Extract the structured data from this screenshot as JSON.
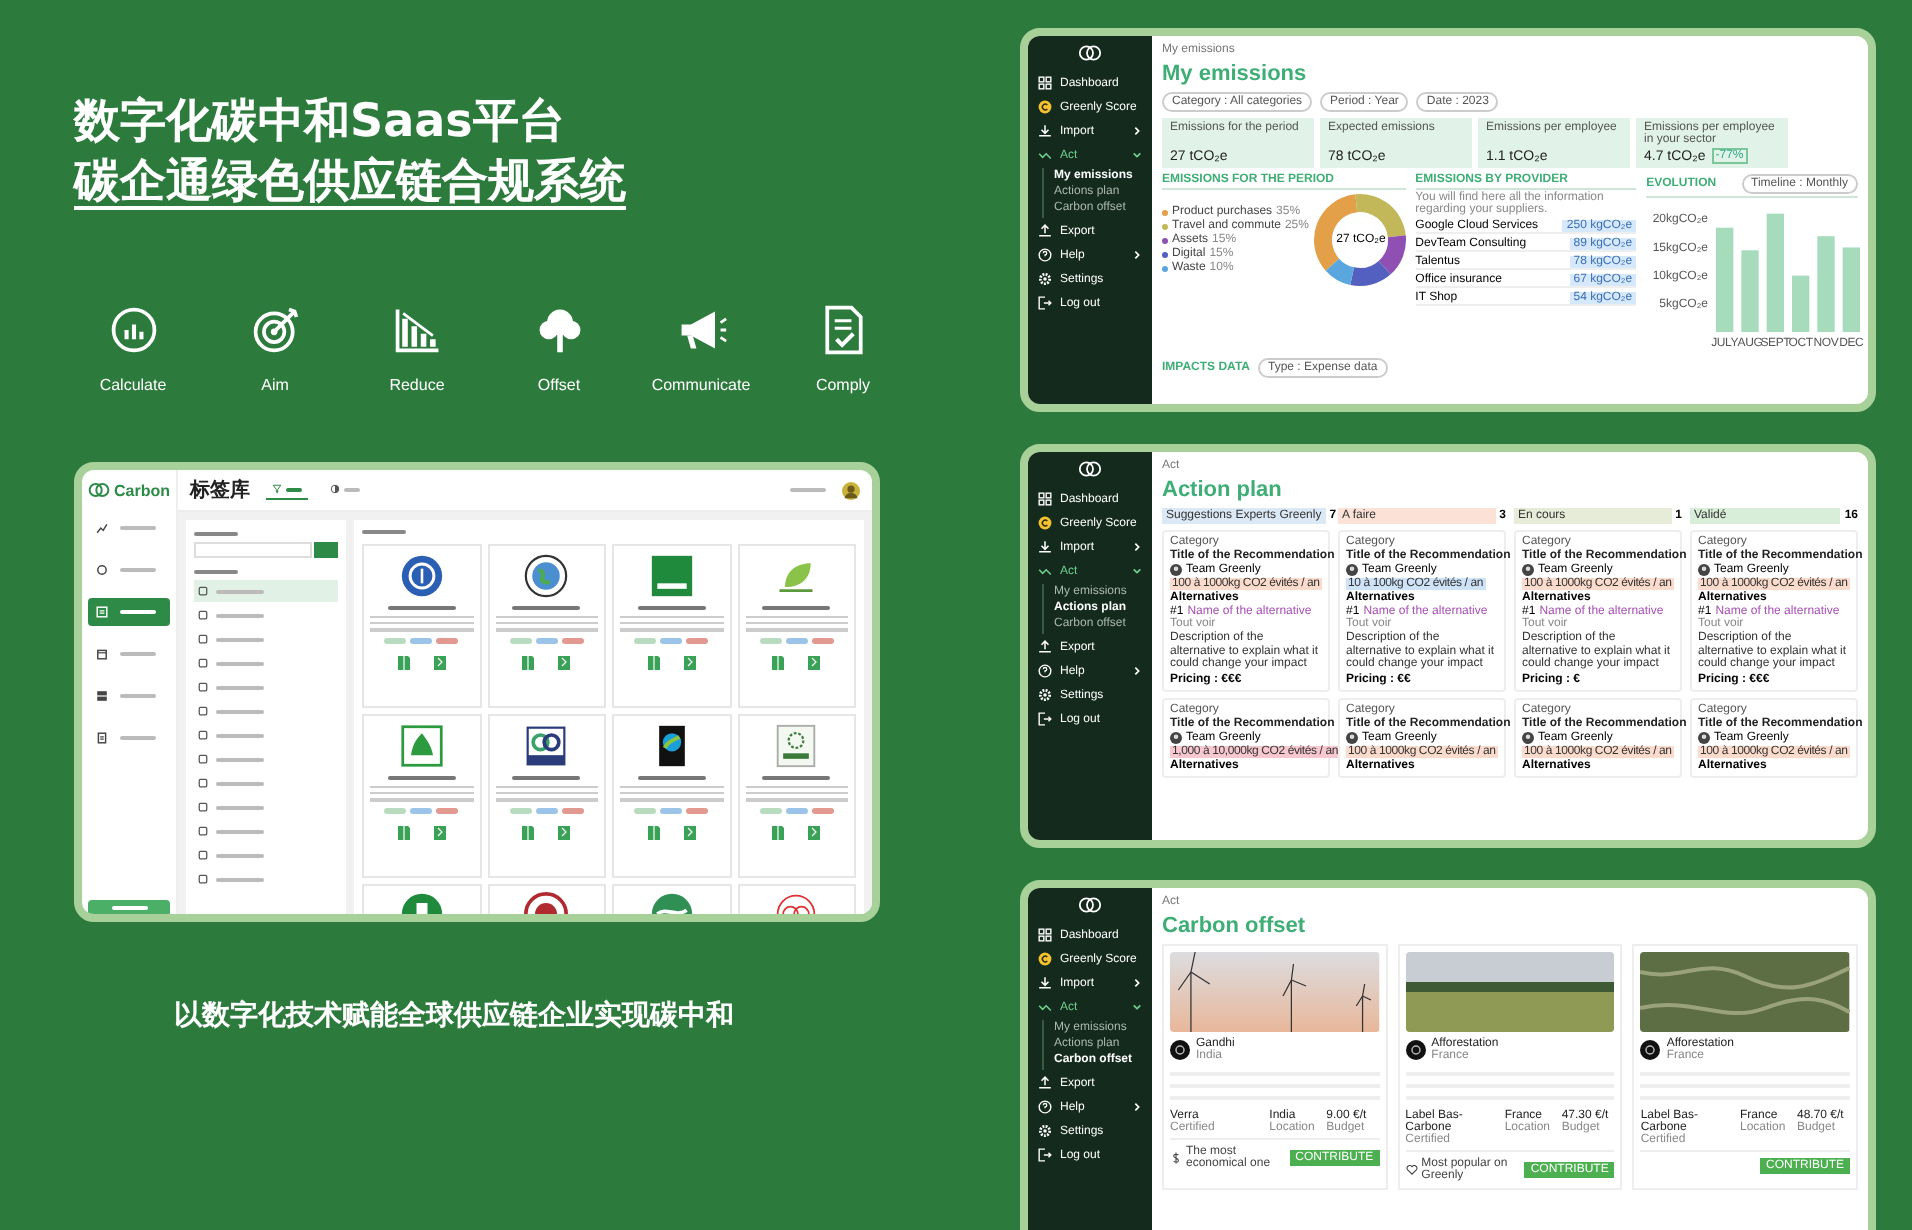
{
  "headline": {
    "line_1": "数字化碳中和Saas平台",
    "line_2": "碳企通绿色供应链合规系统"
  },
  "features": [
    {
      "label": "Calculate",
      "kind": "calculate"
    },
    {
      "label": "Aim",
      "kind": "aim"
    },
    {
      "label": "Reduce",
      "kind": "reduce"
    },
    {
      "label": "Offset",
      "kind": "offset"
    },
    {
      "label": "Communicate",
      "kind": "communicate"
    },
    {
      "label": "Comply",
      "kind": "comply"
    }
  ],
  "label_app": {
    "brand": "Carbon",
    "nav": [
      {
        "kind": "chart",
        "selected": false
      },
      {
        "kind": "leaf",
        "selected": false
      },
      {
        "kind": "label",
        "selected": true
      },
      {
        "kind": "calendar",
        "selected": false
      },
      {
        "kind": "grid",
        "selected": false
      },
      {
        "kind": "clipboard",
        "selected": false
      }
    ],
    "page_title": "标签库",
    "tabs": [
      {
        "kind": "filter",
        "selected": true
      },
      {
        "kind": "contrast",
        "selected": false
      }
    ],
    "categories": [
      {
        "selected": true
      },
      {
        "selected": false
      },
      {
        "selected": false
      },
      {
        "selected": false
      },
      {
        "selected": false
      },
      {
        "selected": false
      },
      {
        "selected": false
      },
      {
        "selected": false
      },
      {
        "selected": false
      },
      {
        "selected": false
      },
      {
        "selected": false
      },
      {
        "selected": false
      },
      {
        "selected": false
      }
    ],
    "cards": [
      {
        "kind": "blue-seal"
      },
      {
        "kind": "globe"
      },
      {
        "kind": "green-square"
      },
      {
        "kind": "leaf-mark"
      },
      {
        "kind": "green-frame"
      },
      {
        "kind": "ring-mark"
      },
      {
        "kind": "fairtrade"
      },
      {
        "kind": "flower-box"
      }
    ],
    "partial_cards": [
      {
        "kind": "green-seal"
      },
      {
        "kind": "red-seal"
      },
      {
        "kind": "swan"
      },
      {
        "kind": "rings"
      }
    ]
  },
  "tagline": "以数字化技术赋能全球供应链企业实现碳中和",
  "emissions": {
    "sidebar": [
      {
        "label": "Dashboard",
        "kind": "dashboard",
        "expandable": false
      },
      {
        "label": "Greenly Score",
        "kind": "score",
        "expandable": false
      },
      {
        "label": "Import",
        "kind": "import",
        "expandable": true,
        "expanded": false
      },
      {
        "label": "Act",
        "kind": "act",
        "expandable": true,
        "expanded": true,
        "children": [
          {
            "label": "My emissions",
            "selected": true
          },
          {
            "label": "Actions plan",
            "selected": false
          },
          {
            "label": "Carbon offset",
            "selected": false
          }
        ]
      },
      {
        "label": "Export",
        "kind": "export",
        "expandable": false
      },
      {
        "label": "Help",
        "kind": "help",
        "expandable": true,
        "expanded": false
      },
      {
        "label": "Settings",
        "kind": "settings",
        "expandable": false
      },
      {
        "label": "Log out",
        "kind": "logout",
        "expandable": false
      }
    ],
    "breadcrumb": "My emissions",
    "title": "My emissions",
    "filters": [
      "Category : All categories",
      "Period : Year",
      "Date : 2023"
    ],
    "kpis": [
      {
        "label": "Emissions for the period",
        "value": "27 tCO₂e"
      },
      {
        "label": "Expected emissions",
        "value": "78 tCO₂e"
      },
      {
        "label": "Emissions per employee",
        "value": "1.1 tCO₂e"
      },
      {
        "label": "Emissions per employee in your sector",
        "value": "4.7 tCO₂e",
        "badge": "-77%"
      }
    ],
    "period": {
      "heading": "EMISSIONS FOR THE PERIOD",
      "center_label": "27 tCO₂e",
      "legend": [
        {
          "share": "35%",
          "color": "#e3a048"
        },
        {
          "share": "25%",
          "color": "#c2b85a"
        },
        {
          "share": "15%",
          "color": "#8f4fb3"
        },
        {
          "share": "15%",
          "color": "#5360c0"
        },
        {
          "share": "10%",
          "color": "#5aa7e0"
        }
      ],
      "chart_data": {
        "type": "donut",
        "categories": [
          "Product purchases",
          "Travel and commute",
          "Assets",
          "Digital",
          "Waste"
        ],
        "values": [
          35,
          25,
          15,
          15,
          10
        ]
      }
    },
    "providers": {
      "heading": "EMISSIONS BY PROVIDER",
      "intro": "You will find here all the information regarding your suppliers.",
      "rows": [
        {
          "name": "Google Cloud Services",
          "value": "250 kgCO₂e"
        },
        {
          "name": "DevTeam Consulting",
          "value": "89 kgCO₂e"
        },
        {
          "name": "Talentus",
          "value": "78 kgCO₂e"
        },
        {
          "name": "Office insurance",
          "value": "67 kgCO₂e"
        },
        {
          "name": "IT Shop",
          "value": "54 kgCO₂e"
        }
      ]
    },
    "evolution": {
      "heading": "EVOLUTION",
      "dropdown": "Timeline : Monthly",
      "chart_data": {
        "type": "bar",
        "categories": [
          "JULY",
          "AUG",
          "SEPT",
          "OCT",
          "NOV",
          "DEC"
        ],
        "series": [
          {
            "color": "#a6dcbc",
            "values": [
              18.5,
              14.5,
              21,
              10,
              17,
              15
            ]
          }
        ],
        "ylim": [
          0,
          22
        ],
        "yticks": [
          {
            "value": 5,
            "label": "5kgCO₂e"
          },
          {
            "value": 10,
            "label": "10kgCO₂e"
          },
          {
            "value": 15,
            "label": "15kgCO₂e"
          },
          {
            "value": 20,
            "label": "20kgCO₂e"
          }
        ]
      }
    },
    "impacts": {
      "heading": "IMPACTS DATA",
      "dropdown": "Type : Expense data"
    }
  },
  "action_plan": {
    "sidebar": [
      {
        "label": "Dashboard",
        "kind": "dashboard",
        "expandable": false
      },
      {
        "label": "Greenly Score",
        "kind": "score",
        "expandable": false
      },
      {
        "label": "Import",
        "kind": "import",
        "expandable": true,
        "expanded": false
      },
      {
        "label": "Act",
        "kind": "act",
        "expandable": true,
        "expanded": true,
        "children": [
          {
            "label": "My emissions",
            "selected": false
          },
          {
            "label": "Actions plan",
            "selected": true
          },
          {
            "label": "Carbon offset",
            "selected": false
          }
        ]
      },
      {
        "label": "Export",
        "kind": "export",
        "expandable": false
      },
      {
        "label": "Help",
        "kind": "help",
        "expandable": true,
        "expanded": false
      },
      {
        "label": "Settings",
        "kind": "settings",
        "expandable": false
      },
      {
        "label": "Log out",
        "kind": "logout",
        "expandable": false
      }
    ],
    "breadcrumb": "Act",
    "title": "Action plan",
    "columns": [
      {
        "title": "Suggestions Experts Greenly",
        "count": "7",
        "color": "#dbe8f5",
        "cards": [
          {
            "category": "Category",
            "title": "Title of the Recommendation",
            "author": "Team Greenly",
            "impact": "100 à 1000kg CO2 évités / an",
            "color": "#fbdccc",
            "alternatives": "Alternatives",
            "alt_index": "#1",
            "alternative": "Name of the alternative",
            "see_all": "Tout voir",
            "description": "Description of the alternative to explain what it could change your impact",
            "pricing": "Pricing : €€€"
          },
          {
            "category": "Category",
            "title": "Title of the Recommendation",
            "author": "Team Greenly",
            "impact": "1,000 à 10,000kg CO2 évités / an",
            "color": "#f8c8d0",
            "alternatives": "Alternatives"
          }
        ]
      },
      {
        "title": "A faire",
        "count": "3",
        "color": "#fbe1d6",
        "cards": [
          {
            "category": "Category",
            "title": "Title of the Recommendation",
            "author": "Team Greenly",
            "impact": "10 à 100kg CO2 évités / an",
            "color": "#cfe3f8",
            "alternatives": "Alternatives",
            "alt_index": "#1",
            "alternative": "Name of the alternative",
            "see_all": "Tout voir",
            "description": "Description of the alternative to explain what it could change your impact",
            "pricing": "Pricing : €€"
          },
          {
            "category": "Category",
            "title": "Title of the Recommendation",
            "author": "Team Greenly",
            "impact": "100 à 1000kg CO2 évités / an",
            "color": "#fbdccc",
            "alternatives": "Alternatives"
          }
        ]
      },
      {
        "title": "En cours",
        "count": "1",
        "color": "#e6ecd8",
        "cards": [
          {
            "category": "Category",
            "title": "Title of the Recommendation",
            "author": "Team Greenly",
            "impact": "100 à 1000kg CO2 évités / an",
            "color": "#fbdccc",
            "alternatives": "Alternatives",
            "alt_index": "#1",
            "alternative": "Name of the alternative",
            "see_all": "Tout voir",
            "description": "Description of the alternative to explain what it could change your impact",
            "pricing": "Pricing : €"
          },
          {
            "category": "Category",
            "title": "Title of the Recommendation",
            "author": "Team Greenly",
            "impact": "100 à 1000kg CO2 évités / an",
            "color": "#fbdccc",
            "alternatives": "Alternatives"
          }
        ]
      },
      {
        "title": "Validé",
        "count": "16",
        "color": "#d9eed9",
        "cards": [
          {
            "category": "Category",
            "title": "Title of the Recommendation",
            "author": "Team Greenly",
            "impact": "100 à 1000kg CO2 évités / an",
            "color": "#fbdccc",
            "alternatives": "Alternatives",
            "alt_index": "#1",
            "alternative": "Name of the alternative",
            "see_all": "Tout voir",
            "description": "Description of the alternative to explain what it could change your impact",
            "pricing": "Pricing : €€€"
          },
          {
            "category": "Category",
            "title": "Title of the Recommendation",
            "author": "Team Greenly",
            "impact": "100 à 1000kg CO2 évités / an",
            "color": "#fbdccc",
            "alternatives": "Alternatives"
          }
        ]
      }
    ]
  },
  "carbon_offset": {
    "sidebar": [
      {
        "label": "Dashboard",
        "kind": "dashboard",
        "expandable": false
      },
      {
        "label": "Greenly Score",
        "kind": "score",
        "expandable": false
      },
      {
        "label": "Import",
        "kind": "import",
        "expandable": true,
        "expanded": false
      },
      {
        "label": "Act",
        "kind": "act",
        "expandable": true,
        "expanded": true,
        "children": [
          {
            "label": "My emissions",
            "selected": false
          },
          {
            "label": "Actions plan",
            "selected": false
          },
          {
            "label": "Carbon offset",
            "selected": true
          }
        ]
      },
      {
        "label": "Export",
        "kind": "export",
        "expandable": false
      },
      {
        "label": "Help",
        "kind": "help",
        "expandable": true,
        "expanded": false
      },
      {
        "label": "Settings",
        "kind": "settings",
        "expandable": false
      },
      {
        "label": "Log out",
        "kind": "logout",
        "expandable": false
      }
    ],
    "breadcrumb": "Act",
    "title": "Carbon offset",
    "projects": [
      {
        "kind": "wind-turbines",
        "name": "Gandhi",
        "country": "India",
        "stats": [
          {
            "value": "Verra",
            "label": "Certified"
          },
          {
            "value": "India",
            "label": "Location"
          },
          {
            "value": "9.00 €/t",
            "label": "Budget"
          }
        ],
        "note": {
          "kind": "dollar",
          "text": "The most economical one"
        },
        "button": "CONTRIBUTE"
      },
      {
        "kind": "meadow",
        "name": "Afforestation",
        "country": "France",
        "stats": [
          {
            "value": "Label Bas-Carbone",
            "label": "Certified"
          },
          {
            "value": "France",
            "label": "Location"
          },
          {
            "value": "47.30 €/t",
            "label": "Budget"
          }
        ],
        "note": {
          "kind": "heart",
          "text": "Most popular on Greenly"
        },
        "button": "CONTRIBUTE"
      },
      {
        "kind": "aerial",
        "name": "Afforestation",
        "country": "France",
        "stats": [
          {
            "value": "Label Bas-Carbone",
            "label": "Certified"
          },
          {
            "value": "France",
            "label": "Location"
          },
          {
            "value": "48.70 €/t",
            "label": "Budget"
          }
        ],
        "button": "CONTRIBUTE"
      }
    ]
  }
}
